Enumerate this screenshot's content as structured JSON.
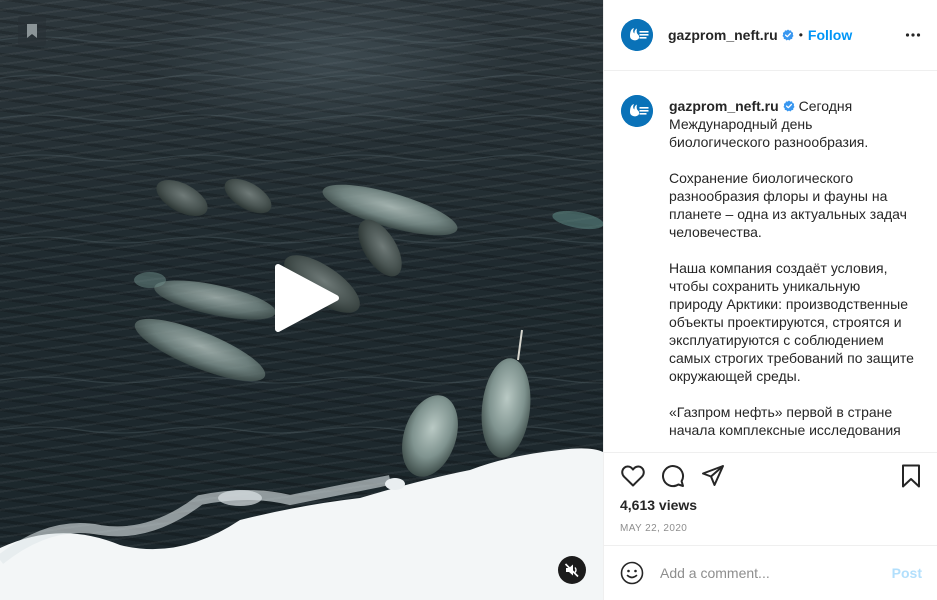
{
  "post": {
    "username": "gazprom_neft.ru",
    "header_separator": "•",
    "follow_label": "Follow",
    "avatar_text": "GAZPROM NEFT",
    "caption_paragraphs": [
      "Сегодня Международный день биологического разнообразия.",
      "Сохранение биологического разнообразия флоры и фауны на планете – одна из актуальных задач человечества.",
      "Наша компания создаёт условия, чтобы сохранить уникальную природу Арктики: производственные объекты проектируются, строятся и эксплуатируются с соблюдением самых строгих требований по защите окружающей среды.",
      "«Газпром нефть» первой в стране начала комплексные исследования"
    ],
    "views": "4,613 views",
    "date": "MAY 22, 2020"
  },
  "comment": {
    "placeholder": "Add a comment...",
    "post_label": "Post"
  },
  "icons": {
    "media_save": "bookmark-icon",
    "play": "play-icon",
    "mute": "muted-speaker-icon",
    "more": "more-options-icon",
    "like": "heart-icon",
    "comment": "comment-icon",
    "share": "share-icon",
    "save": "bookmark-icon",
    "emoji": "emoji-icon",
    "verified": "verified-badge-icon"
  },
  "colors": {
    "accent": "#0095f6",
    "post_disabled": "#b2dffc",
    "avatar_bg": "#0a72b8",
    "verified": "#3897f0",
    "muted_text": "#8e8e8e"
  }
}
